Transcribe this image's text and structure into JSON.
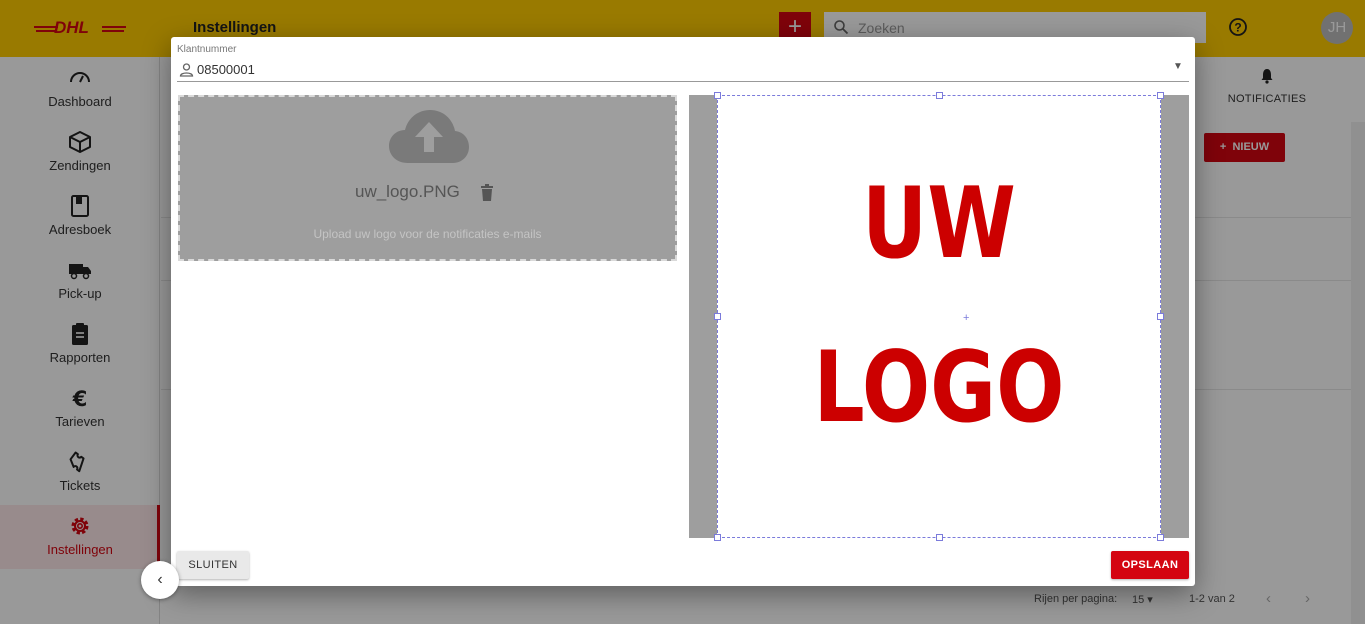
{
  "topbar": {
    "logo_text": "DHL",
    "page_title": "Instellingen",
    "add_label": "+",
    "search_placeholder": "Zoeken",
    "avatar_initials": "JH"
  },
  "sidebar": {
    "items": [
      {
        "label": "Dashboard",
        "icon": "speedometer-icon"
      },
      {
        "label": "Zendingen",
        "icon": "package-icon"
      },
      {
        "label": "Adresboek",
        "icon": "address-book-icon"
      },
      {
        "label": "Pick-up",
        "icon": "truck-icon"
      },
      {
        "label": "Rapporten",
        "icon": "clipboard-icon"
      },
      {
        "label": "Tarieven",
        "icon": "euro-icon"
      },
      {
        "label": "Tickets",
        "icon": "ticket-icon"
      },
      {
        "label": "Instellingen",
        "icon": "gear-icon",
        "active": true
      }
    ],
    "collapse_label": "‹"
  },
  "background": {
    "notifications_label": "NOTIFICATIES",
    "new_button_label": "NIEUW",
    "rows_per_page_label": "Rijen per pagina:",
    "rows_per_page_value": "15",
    "range_label": "1-2 van 2"
  },
  "dialog": {
    "customer_field": {
      "label": "Klantnummer",
      "value": "08500001"
    },
    "upload": {
      "file_name": "uw_logo.PNG",
      "hint": "Upload uw logo voor de notificaties e-mails"
    },
    "preview": {
      "logo_line_1": "UW",
      "logo_line_2": "LOGO"
    },
    "close_label": "SLUITEN",
    "save_label": "OPSLAAN"
  },
  "colors": {
    "brand_yellow": "#ffcc00",
    "brand_red": "#d40511",
    "logo_red": "#cc0000"
  }
}
